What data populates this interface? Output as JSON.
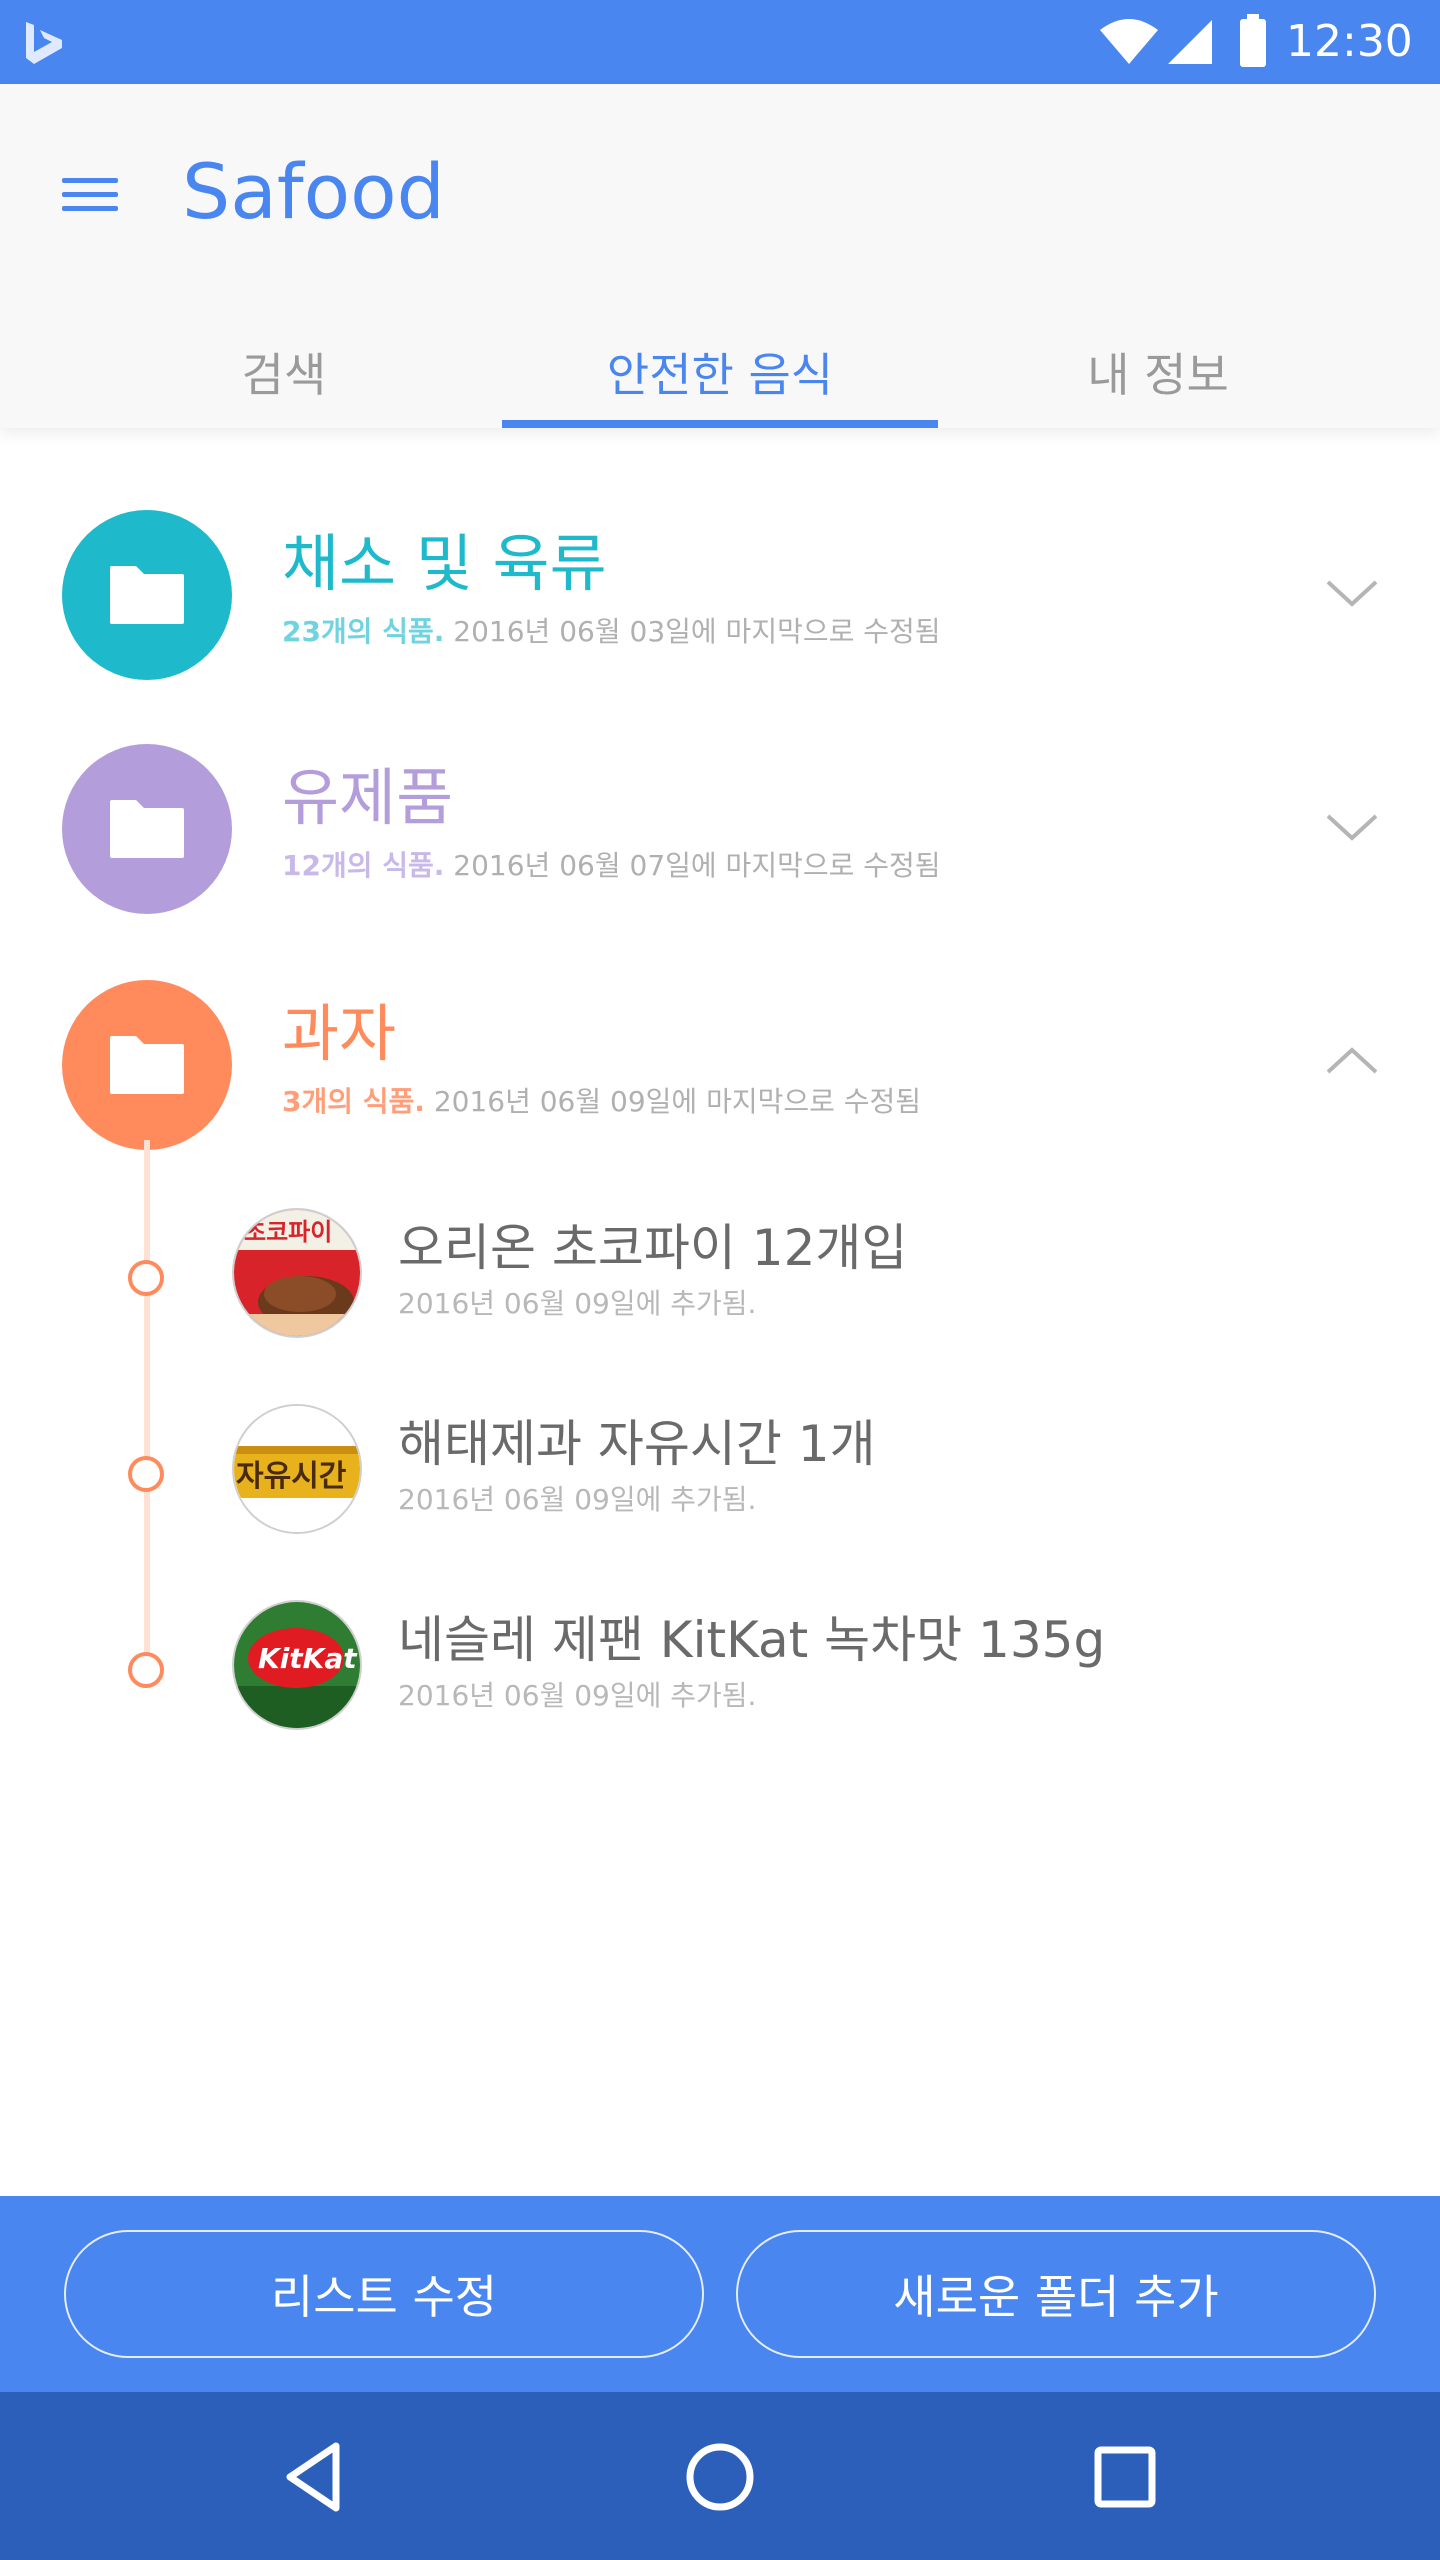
{
  "status_bar": {
    "time": "12:30"
  },
  "app_bar": {
    "title": "Safood"
  },
  "tabs": [
    {
      "label": "검색"
    },
    {
      "label": "안전한 음식"
    },
    {
      "label": "내 정보"
    }
  ],
  "colors": {
    "primary": "#4a86f0",
    "nav": "#2b5fba",
    "vegetables": "#1fb9cc",
    "dairy": "#b39ddb",
    "snacks": "#ff8a5c"
  },
  "folders": [
    {
      "name": "채소 및 육류",
      "count": "23개의 식품.",
      "modified": "2016년 06월 03일에 마지막으로 수정됨",
      "icon": "folder-icon",
      "expanded": false
    },
    {
      "name": "유제품",
      "count": "12개의 식품.",
      "modified": "2016년 06월 07일에 마지막으로 수정됨",
      "icon": "folder-icon",
      "expanded": false
    },
    {
      "name": "과자",
      "count": "3개의 식품.",
      "modified": "2016년 06월 09일에 마지막으로 수정됨",
      "icon": "folder-icon",
      "expanded": true
    }
  ],
  "snack_items": [
    {
      "title": "오리온 초코파이 12개입",
      "sub": "2016년 06월 09일에 추가됨."
    },
    {
      "title": "해태제과 자유시간 1개",
      "sub": "2016년 06월 09일에 추가됨."
    },
    {
      "title": "네슬레 제팬 KitKat 녹차맛 135g",
      "sub": "2016년 06월 09일에 추가됨."
    }
  ],
  "thumb_labels": {
    "chocopie": "초코파이",
    "jayu": "자유시간",
    "kitkat": "KitKat"
  },
  "actions": {
    "edit_list": "리스트 수정",
    "add_folder": "새로운 폴더 추가"
  }
}
